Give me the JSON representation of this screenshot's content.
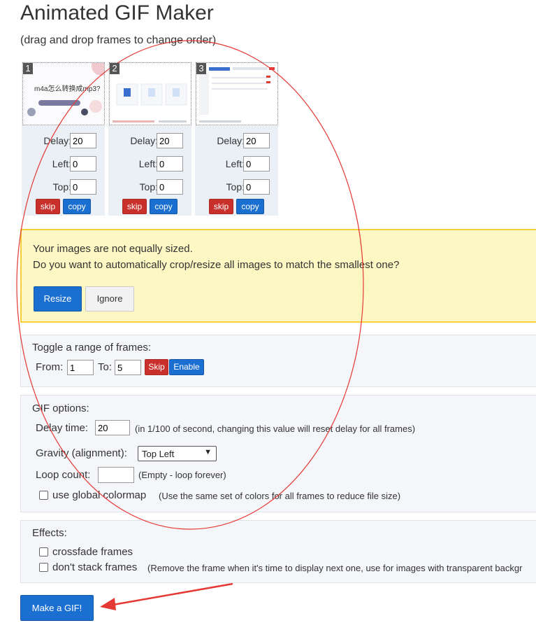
{
  "page": {
    "title": "Animated GIF Maker",
    "subtitle": "(drag and drop frames to change order)"
  },
  "frames": [
    {
      "number": "1",
      "thumb_text": "m4a怎么转换成mp3?",
      "delay": "20",
      "left": "0",
      "top": "0"
    },
    {
      "number": "2",
      "delay": "20",
      "left": "0",
      "top": "0"
    },
    {
      "number": "3",
      "delay": "20",
      "left": "0",
      "top": "0"
    }
  ],
  "frame_labels": {
    "delay": "Delay:",
    "left": "Left:",
    "top": "Top:",
    "skip": "skip",
    "copy": "copy"
  },
  "warning": {
    "line1": "Your images are not equally sized.",
    "line2": "Do you want to automatically crop/resize all images to match the smallest one?",
    "resize_label": "Resize",
    "ignore_label": "Ignore"
  },
  "toggle": {
    "title": "Toggle a range of frames:",
    "from_label": "From:",
    "from_value": "1",
    "to_label": "To:",
    "to_value": "5",
    "skip_label": "Skip",
    "enable_label": "Enable"
  },
  "gif_options": {
    "title": "GIF options:",
    "delay_label": "Delay time:",
    "delay_value": "20",
    "delay_hint": "(in 1/100 of second, changing this value will reset delay for all frames)",
    "gravity_label": "Gravity (alignment):",
    "gravity_value": "Top Left",
    "loop_label": "Loop count:",
    "loop_value": "",
    "loop_hint": "(Empty - loop forever)",
    "colormap_label": "use global colormap",
    "colormap_hint": "(Use the same set of colors for all frames to reduce file size)"
  },
  "effects": {
    "title": "Effects:",
    "crossfade_label": "crossfade frames",
    "nostack_label": "don't stack frames",
    "nostack_hint": "(Remove the frame when it's time to display next one, use for images with transparent backgr"
  },
  "make_gif_label": "Make a GIF!",
  "colors": {
    "red_button": "#c9302c",
    "blue_button": "#1a6fd0",
    "annotation": "#e53935",
    "warning_bg": "#fdf7c3"
  }
}
